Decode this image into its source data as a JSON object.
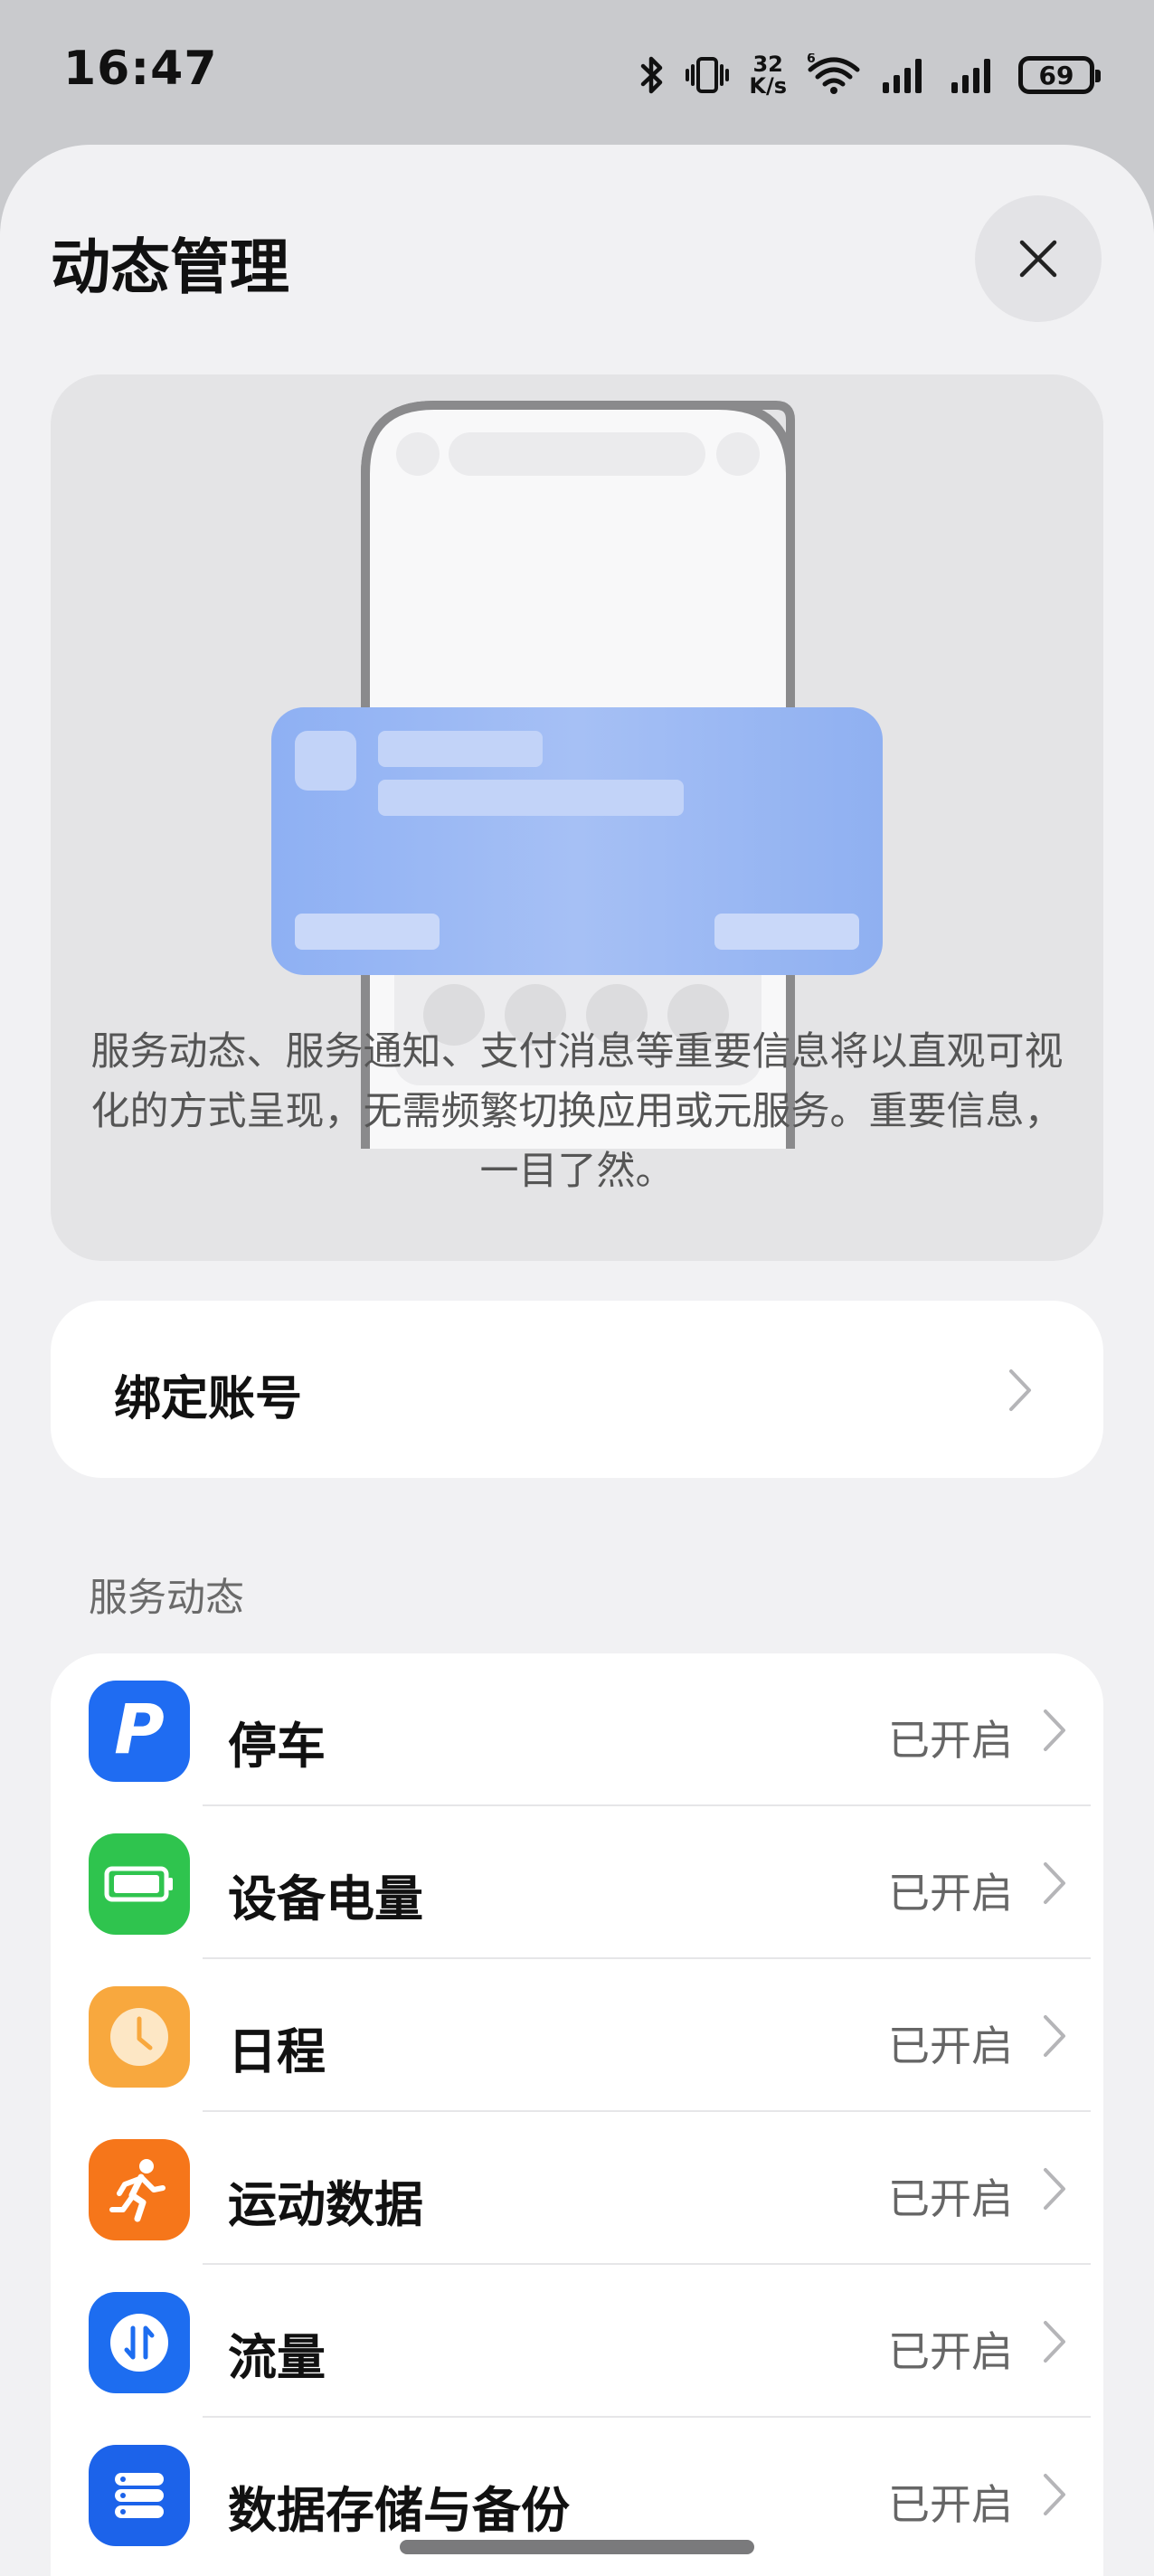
{
  "status_bar": {
    "time": "16:47",
    "net_speed_value": "32",
    "net_speed_unit": "K/s",
    "battery": "69",
    "icons": [
      "bluetooth-icon",
      "vibrate-icon",
      "wifi-icon",
      "signal-icon",
      "signal-icon",
      "battery-icon"
    ]
  },
  "sheet": {
    "title": "动态管理",
    "close_icon": "close-icon"
  },
  "hero": {
    "description": "服务动态、服务通知、支付消息等重要信息将以直观可视化的方式呈现，无需频繁切换应用或元服务。重要信息，一目了然。"
  },
  "bind_account": {
    "label": "绑定账号"
  },
  "section": {
    "label": "服务动态"
  },
  "services": [
    {
      "label": "停车",
      "status": "已开启",
      "icon": "parking-icon",
      "color": "#1f6cf2"
    },
    {
      "label": "设备电量",
      "status": "已开启",
      "icon": "battery-level-icon",
      "color": "#2fc44e"
    },
    {
      "label": "日程",
      "status": "已开启",
      "icon": "clock-icon",
      "color": "#f8a83e"
    },
    {
      "label": "运动数据",
      "status": "已开启",
      "icon": "running-icon",
      "color": "#f6761a"
    },
    {
      "label": "流量",
      "status": "已开启",
      "icon": "data-traffic-icon",
      "color": "#1d6df0"
    },
    {
      "label": "数据存储与备份",
      "status": "已开启",
      "icon": "storage-icon",
      "color": "#1c63ea"
    }
  ]
}
